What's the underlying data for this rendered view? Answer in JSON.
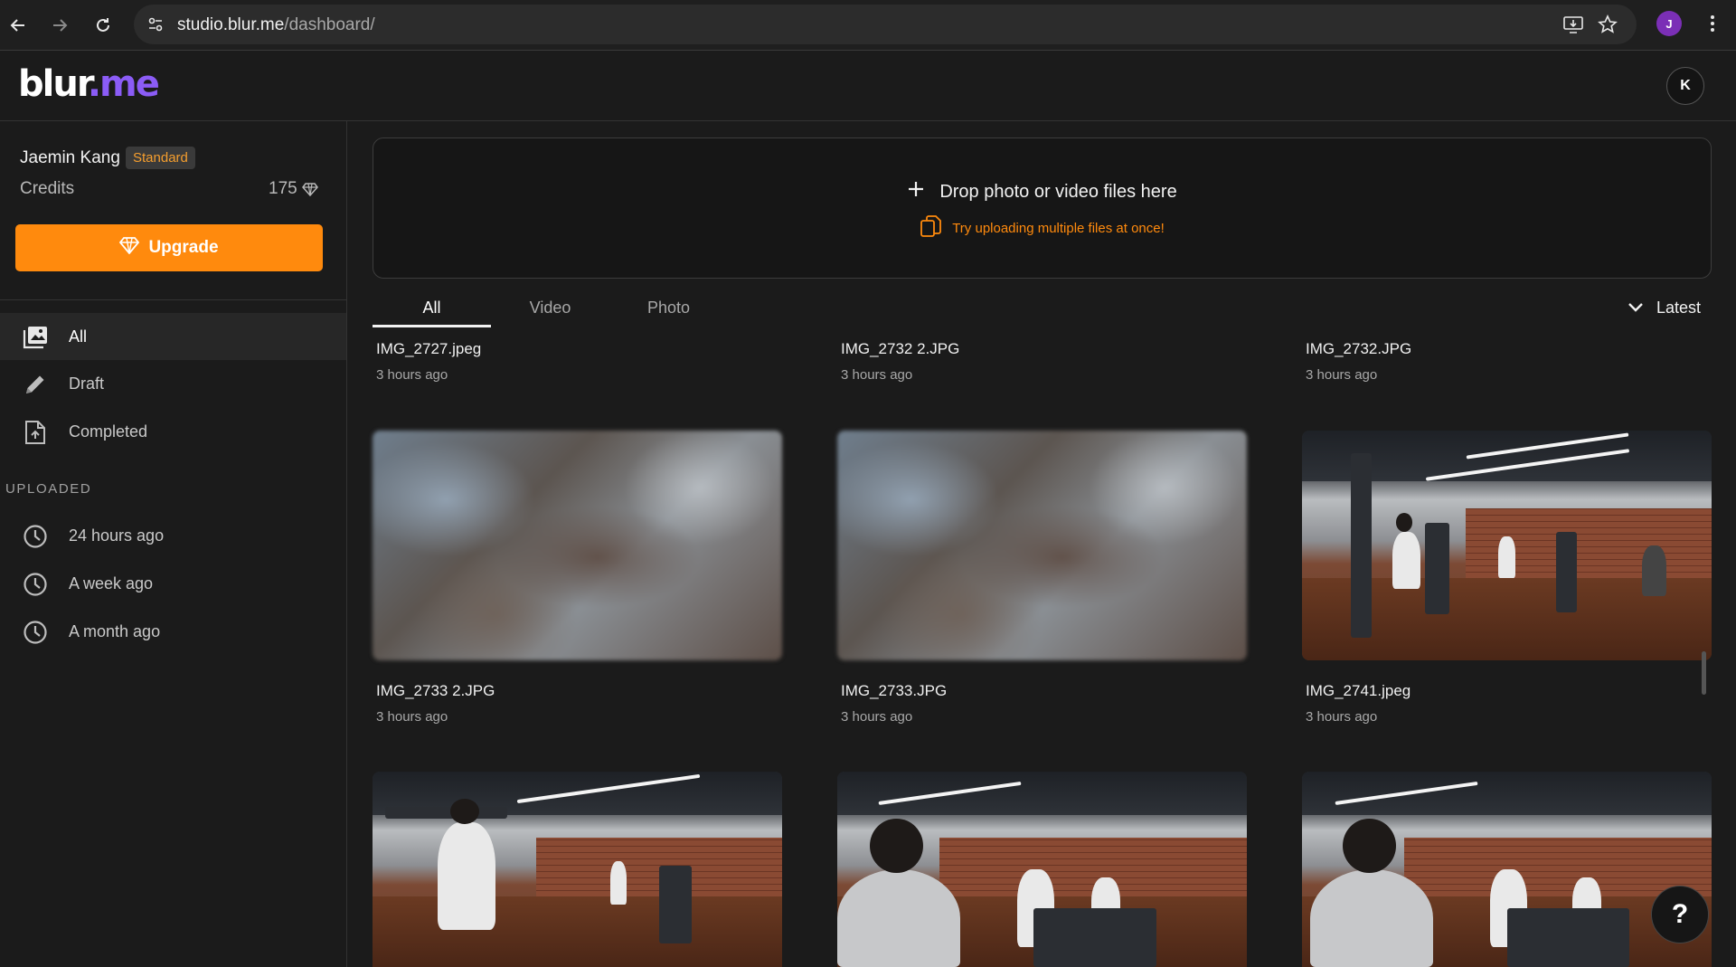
{
  "browser": {
    "url_host": "studio.blur.me",
    "url_path": "/dashboard/",
    "profile_initial": "J"
  },
  "header": {
    "logo_main": "blur",
    "logo_accent": ".me",
    "account_initial": "K"
  },
  "sidebar": {
    "user_name": "Jaemin Kang",
    "plan": "Standard",
    "credits_label": "Credits",
    "credits_value": "175",
    "upgrade_label": "Upgrade",
    "nav": [
      {
        "label": "All",
        "icon": "gallery-icon",
        "active": true
      },
      {
        "label": "Draft",
        "icon": "pencil-icon",
        "active": false
      },
      {
        "label": "Completed",
        "icon": "file-upload-icon",
        "active": false
      }
    ],
    "uploaded_heading": "UPLOADED",
    "uploaded": [
      {
        "label": "24 hours ago",
        "icon": "clock-icon"
      },
      {
        "label": "A week ago",
        "icon": "clock-icon"
      },
      {
        "label": "A month ago",
        "icon": "clock-icon"
      }
    ]
  },
  "dropzone": {
    "title": "Drop photo or video files here",
    "hint": "Try uploading multiple files at once!"
  },
  "tabs": [
    "All",
    "Video",
    "Photo"
  ],
  "sort_label": "Latest",
  "files": [
    {
      "name": "IMG_2727.jpeg",
      "time": "3 hours ago"
    },
    {
      "name": "IMG_2732 2.JPG",
      "time": "3 hours ago"
    },
    {
      "name": "IMG_2732.JPG",
      "time": "3 hours ago"
    },
    {
      "name": "IMG_2733 2.JPG",
      "time": "3 hours ago"
    },
    {
      "name": "IMG_2733.JPG",
      "time": "3 hours ago"
    },
    {
      "name": "IMG_2741.jpeg",
      "time": "3 hours ago"
    }
  ],
  "help_label": "?",
  "colors": {
    "accent_orange": "#ff8a0d",
    "logo_purple": "#8b5cf6",
    "background": "#1b1b1b"
  }
}
